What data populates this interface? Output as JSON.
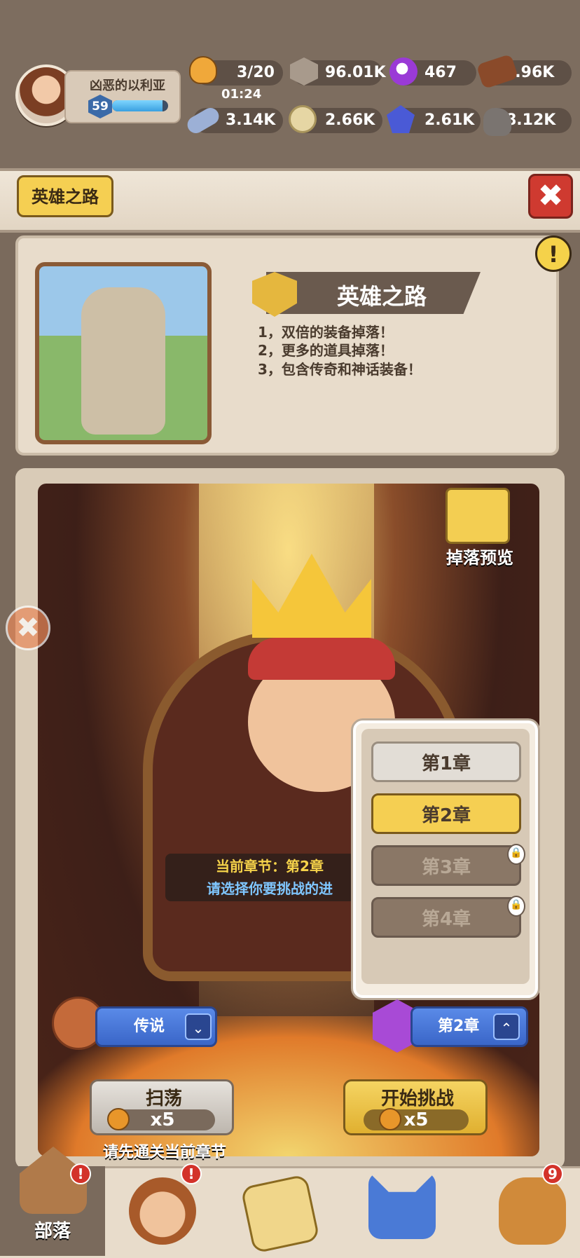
{
  "player": {
    "name": "凶恶的以利亚",
    "level": "59",
    "xp_fraction": 0.9
  },
  "resources": {
    "meat": {
      "value": "3/20",
      "timer": "01:24",
      "icon": "meat-icon"
    },
    "stone_nut": {
      "value": "96.01K",
      "icon": "stone-nut-icon"
    },
    "purple_orb": {
      "value": "467",
      "icon": "purple-orb-icon"
    },
    "wood": {
      "value": "3.96K",
      "icon": "wood-icon"
    },
    "bone": {
      "value": "3.14K",
      "icon": "bone-icon"
    },
    "egg": {
      "value": "2.66K",
      "icon": "egg-icon"
    },
    "gem": {
      "value": "2.61K",
      "icon": "blue-gem-icon"
    },
    "rock": {
      "value": "8.12K",
      "icon": "rock-icon"
    }
  },
  "header": {
    "title": "英雄之路",
    "close": "✖"
  },
  "info": {
    "title": "英雄之路",
    "alert": "!",
    "lines": [
      "1，双倍的装备掉落！",
      "2，更多的道具掉落！",
      "3，包含传奇和神话装备！"
    ]
  },
  "stage": {
    "drop_preview": "掉落预览",
    "current_chapter": "当前章节：第2章",
    "choose_prompt": "请选择你要挑战的进",
    "side_icon": "✖"
  },
  "chapters": [
    {
      "label": "第1章",
      "state": "normal"
    },
    {
      "label": "第2章",
      "state": "selected"
    },
    {
      "label": "第3章",
      "state": "locked"
    },
    {
      "label": "第4章",
      "state": "locked"
    }
  ],
  "difficulty": {
    "label": "传说",
    "chevron": "⌄"
  },
  "chapter_select": {
    "label": "第2章",
    "chevron": "⌃"
  },
  "sweep": {
    "label": "扫荡",
    "cost": "x5",
    "hint": "请先通关当前章节"
  },
  "challenge": {
    "label": "开始挑战",
    "cost": "x5"
  },
  "nav": {
    "tribe": {
      "label": "部落",
      "badge": "!"
    },
    "hero": {
      "badge": "!"
    },
    "map": {},
    "pet": {},
    "bag": {
      "badge": "9"
    }
  },
  "colors": {
    "accent": "#f5cf52",
    "danger": "#cf3a30",
    "blue": "#3a66c8",
    "bg": "#7d6d5f"
  }
}
